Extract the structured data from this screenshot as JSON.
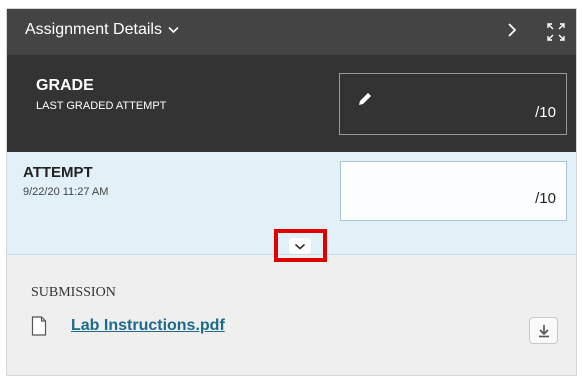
{
  "header": {
    "title": "Assignment Details",
    "icons": {
      "title_dropdown": "chevron-down-icon",
      "next": "chevron-right-icon",
      "expand": "fullscreen-icon"
    }
  },
  "grade": {
    "label": "GRADE",
    "sublabel": "LAST GRADED ATTEMPT",
    "score": "/10",
    "icon": "pencil-icon"
  },
  "attempt": {
    "label": "ATTEMPT",
    "date": "9/22/20 11:27 AM",
    "score": "/10",
    "expand_icon": "chevron-down-icon",
    "highlight_color": "#e00000"
  },
  "submission": {
    "label": "SUBMISSION",
    "file_name": "Lab Instructions.pdf",
    "file_icon": "document-icon",
    "download_icon": "download-icon"
  },
  "colors": {
    "header_bg": "#444444",
    "grade_bg": "#333333",
    "attempt_bg": "#e2f1f8",
    "link": "#1d6a8a"
  }
}
